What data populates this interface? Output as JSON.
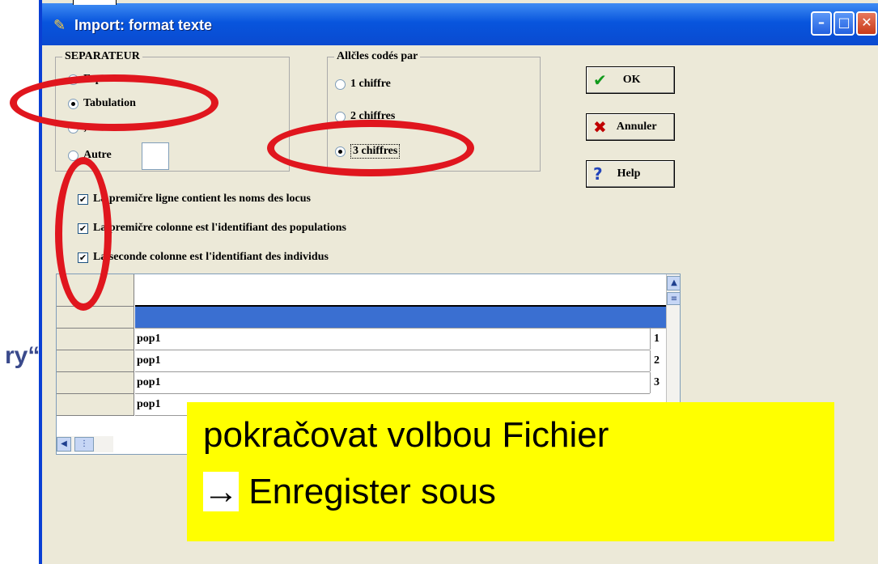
{
  "background_text": "ry“",
  "window": {
    "title": "Import: format texte",
    "controls": {
      "minimize": "–",
      "maximize": "□",
      "close": "✕"
    }
  },
  "separator": {
    "label": "SEPARATEUR",
    "options": [
      {
        "label": "Espace",
        "selected": false
      },
      {
        "label": "Tabulation",
        "selected": true
      },
      {
        "label": ";",
        "selected": false
      },
      {
        "label": "Autre",
        "selected": false
      }
    ],
    "autre_value": ""
  },
  "alleles": {
    "label": "Allčles codés par",
    "options": [
      {
        "label": "1 chiffre",
        "selected": false
      },
      {
        "label": "2 chiffres",
        "selected": false
      },
      {
        "label": "3 chiffres",
        "selected": true
      }
    ]
  },
  "buttons": {
    "ok": "OK",
    "cancel": "Annuler",
    "help": "Help"
  },
  "checkboxes": [
    {
      "label": "La premičre ligne contient les noms des locus",
      "checked": true
    },
    {
      "label": "La premičre colonne est l'identifiant des populations",
      "checked": true
    },
    {
      "label": "La seconde colonne est l'identifiant des individus",
      "checked": true
    }
  ],
  "grid": {
    "rows": [
      {
        "value": "",
        "number": ""
      },
      {
        "value": "pop1",
        "number": "1"
      },
      {
        "value": "pop1",
        "number": "2"
      },
      {
        "value": "pop1",
        "number": "3"
      },
      {
        "value": "pop1",
        "number": ""
      }
    ]
  },
  "note": {
    "line1": "pokračovat volbou Fichier",
    "arrow": "→",
    "line2": " Enregister sous"
  },
  "colors": {
    "annotation": "#e0161e",
    "note_bg": "#ffff00",
    "selected_row": "#3a6fd1"
  }
}
